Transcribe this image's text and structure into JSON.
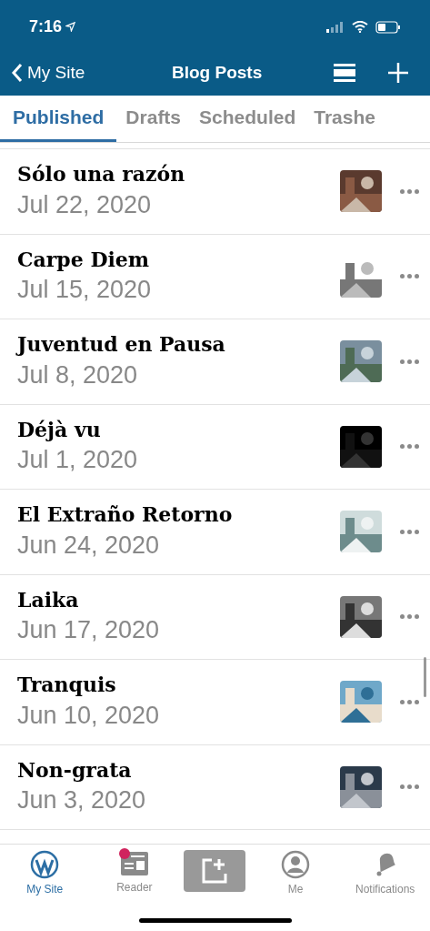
{
  "status_bar": {
    "time": "7:16"
  },
  "nav": {
    "back": "My Site",
    "title": "Blog Posts"
  },
  "tabs": [
    {
      "label": "Published",
      "selected": true
    },
    {
      "label": "Drafts",
      "selected": false
    },
    {
      "label": "Scheduled",
      "selected": false
    },
    {
      "label": "Trashe",
      "selected": false
    }
  ],
  "posts": [
    {
      "title": "Sólo una razón",
      "date": "Jul 22, 2020"
    },
    {
      "title": "Carpe Diem",
      "date": "Jul 15, 2020"
    },
    {
      "title": "Juventud en Pausa",
      "date": "Jul 8, 2020"
    },
    {
      "title": "Déjà vu",
      "date": "Jul 1, 2020"
    },
    {
      "title": "El Extraño Retorno",
      "date": "Jun 24, 2020"
    },
    {
      "title": "Laika",
      "date": "Jun 17, 2020"
    },
    {
      "title": "Tranquis",
      "date": "Jun 10, 2020"
    },
    {
      "title": "Non-grata",
      "date": "Jun 3, 2020"
    }
  ],
  "tab_bar": [
    {
      "kind": "site",
      "label": "My Site",
      "selected": true,
      "badge": false
    },
    {
      "kind": "reader",
      "label": "Reader",
      "selected": false,
      "badge": true
    },
    {
      "kind": "compose",
      "selected": false
    },
    {
      "kind": "me",
      "label": "Me",
      "selected": false,
      "badge": false
    },
    {
      "kind": "notifications",
      "label": "Notifications",
      "selected": false,
      "badge": false
    }
  ]
}
